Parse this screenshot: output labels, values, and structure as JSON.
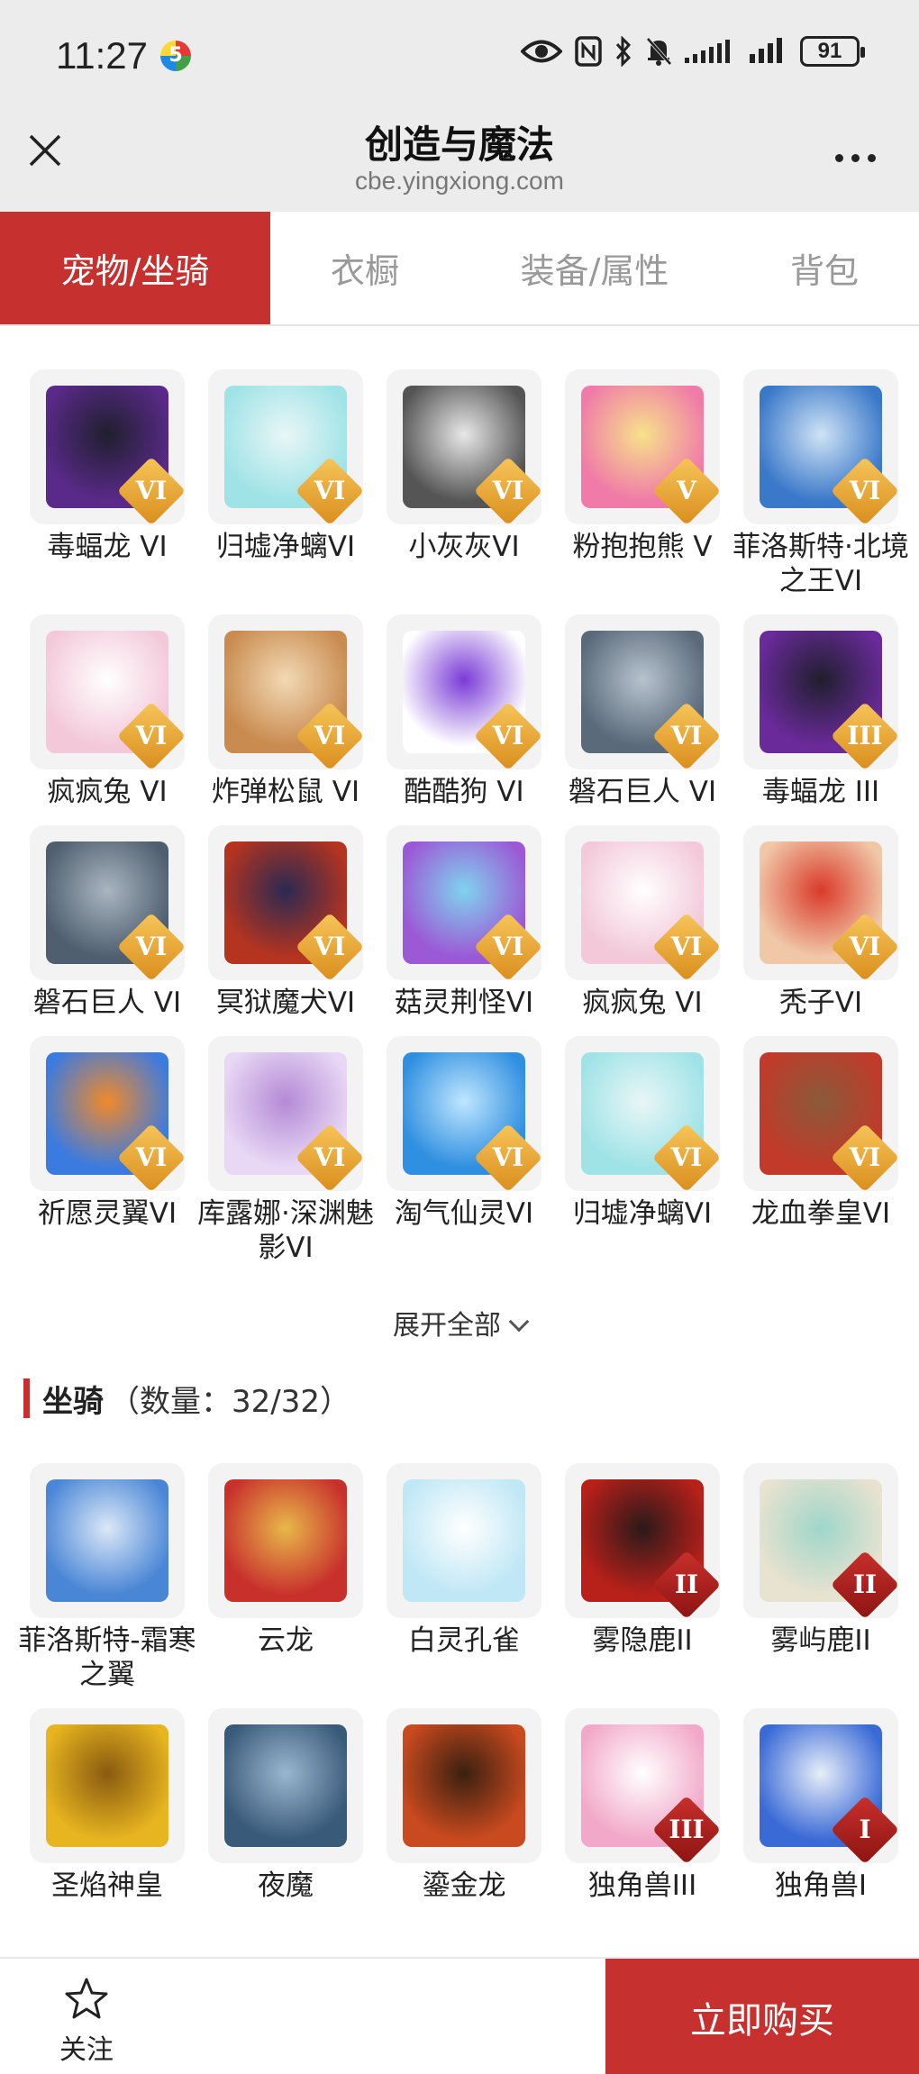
{
  "status_bar": {
    "time": "11:27",
    "badge": "5",
    "battery": "91"
  },
  "header": {
    "title": "创造与魔法",
    "url": "cbe.yingxiong.com"
  },
  "tabs": [
    {
      "label": "宠物/坐骑",
      "active": true
    },
    {
      "label": "衣橱",
      "active": false
    },
    {
      "label": "装备/属性",
      "active": false
    },
    {
      "label": "背包",
      "active": false
    }
  ],
  "pets": [
    {
      "name": "毒蝠龙 VI",
      "rank": "VI",
      "colors": [
        "#5a2a8a",
        "#1f1f2e"
      ]
    },
    {
      "name": "归墟净螭VI",
      "rank": "VI",
      "colors": [
        "#9fe3e6",
        "#e9f6f7"
      ]
    },
    {
      "name": "小灰灰VI",
      "rank": "VI",
      "colors": [
        "#555555",
        "#e8e8e8"
      ]
    },
    {
      "name": "粉抱抱熊 V",
      "rank": "V",
      "colors": [
        "#f07aa8",
        "#f7e28a"
      ]
    },
    {
      "name": "菲洛斯特·北境之王VI",
      "rank": "VI",
      "colors": [
        "#3a78c9",
        "#cfe3f5"
      ]
    },
    {
      "name": "疯疯兔 VI",
      "rank": "VI",
      "colors": [
        "#f3c9d9",
        "#ffffff"
      ]
    },
    {
      "name": "炸弹松鼠 VI",
      "rank": "VI",
      "colors": [
        "#c98b4f",
        "#f2d9b5"
      ]
    },
    {
      "name": "酷酷狗 VI",
      "rank": "VI",
      "colors": [
        "#ffffff",
        "#7a3bd6"
      ]
    },
    {
      "name": "磐石巨人 VI",
      "rank": "VI",
      "colors": [
        "#5a6a7a",
        "#b7c3cf"
      ]
    },
    {
      "name": "毒蝠龙 III",
      "rank": "III",
      "colors": [
        "#6a2a9a",
        "#1f1f2e"
      ]
    },
    {
      "name": "磐石巨人 VI",
      "rank": "VI",
      "colors": [
        "#4f5f6f",
        "#a9b5c1"
      ]
    },
    {
      "name": "冥狱魔犬VI",
      "rank": "VI",
      "colors": [
        "#b5341f",
        "#2a2a52"
      ]
    },
    {
      "name": "菇灵荆怪VI",
      "rank": "VI",
      "colors": [
        "#9b59d6",
        "#7fd3ee"
      ]
    },
    {
      "name": "疯疯兔 VI",
      "rank": "VI",
      "colors": [
        "#f3c9d9",
        "#ffffff"
      ]
    },
    {
      "name": "秃子VI",
      "rank": "VI",
      "colors": [
        "#f0c8a8",
        "#d93a2a"
      ]
    },
    {
      "name": "祈愿灵翼VI",
      "rank": "VI",
      "colors": [
        "#3b7be0",
        "#f08a2a"
      ]
    },
    {
      "name": "库露娜·深渊魅影VI",
      "rank": "VI",
      "colors": [
        "#e8d8f5",
        "#b48ad6"
      ]
    },
    {
      "name": "淘气仙灵VI",
      "rank": "VI",
      "colors": [
        "#2f8fe0",
        "#bfe6ff"
      ]
    },
    {
      "name": "归墟净螭VI",
      "rank": "VI",
      "colors": [
        "#9fe3e6",
        "#e9f6f7"
      ]
    },
    {
      "name": "龙血拳皇VI",
      "rank": "VI",
      "colors": [
        "#c23a2a",
        "#8a5a3a"
      ]
    }
  ],
  "expand_label": "展开全部",
  "mounts_section": {
    "title": "坐骑",
    "count": "（数量：32/32）"
  },
  "mounts": [
    {
      "name": "菲洛斯特-霜寒之翼",
      "rank": "",
      "colors": [
        "#4a86d6",
        "#dbe8f7"
      ]
    },
    {
      "name": "云龙",
      "rank": "",
      "colors": [
        "#c8302c",
        "#e8b84a"
      ]
    },
    {
      "name": "白灵孔雀",
      "rank": "",
      "colors": [
        "#bfe7f5",
        "#ffffff"
      ]
    },
    {
      "name": "雾隐鹿II",
      "rank": "II",
      "colors": [
        "#b8201a",
        "#2a1a1a"
      ]
    },
    {
      "name": "雾屿鹿II",
      "rank": "II",
      "colors": [
        "#e8e2d0",
        "#9fd6c9"
      ]
    },
    {
      "name": "圣焰神皇",
      "rank": "",
      "colors": [
        "#e7b51f",
        "#8a5a10"
      ]
    },
    {
      "name": "夜魔",
      "rank": "",
      "colors": [
        "#3a5a7a",
        "#9ab7cf"
      ]
    },
    {
      "name": "鎏金龙",
      "rank": "",
      "colors": [
        "#c94a1f",
        "#3a2010"
      ]
    },
    {
      "name": "独角兽III",
      "rank": "III",
      "colors": [
        "#f2a9c9",
        "#ffffff"
      ]
    },
    {
      "name": "独角兽I",
      "rank": "I",
      "colors": [
        "#3a6ad6",
        "#e8eef8"
      ]
    }
  ],
  "bottom": {
    "follow_label": "关注",
    "buy_label": "立即购买"
  }
}
